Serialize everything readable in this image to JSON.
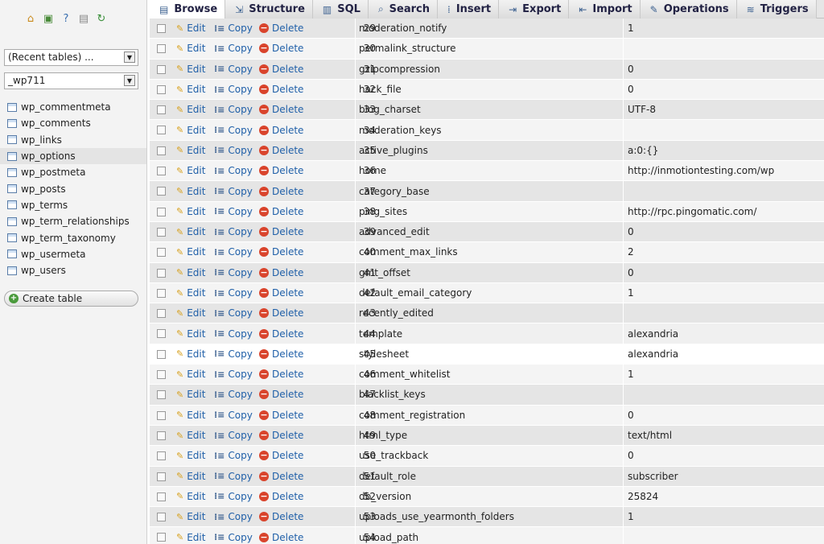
{
  "sidebar": {
    "top_icons": [
      {
        "name": "home-icon",
        "glyph": "⌂",
        "color": "#c98a1c"
      },
      {
        "name": "logout-icon",
        "glyph": "▣",
        "color": "#4a8b3a"
      },
      {
        "name": "help-icon",
        "glyph": "?",
        "color": "#3a6fb0"
      },
      {
        "name": "docs-icon",
        "glyph": "▤",
        "color": "#888888"
      },
      {
        "name": "reload-icon",
        "glyph": "↻",
        "color": "#3a8f3a"
      }
    ],
    "recent_tables": "(Recent tables) ...",
    "database": "_wp711",
    "tables": [
      "wp_commentmeta",
      "wp_comments",
      "wp_links",
      "wp_options",
      "wp_postmeta",
      "wp_posts",
      "wp_terms",
      "wp_term_relationships",
      "wp_term_taxonomy",
      "wp_usermeta",
      "wp_users"
    ],
    "active_table": "wp_options",
    "create_table": "Create table"
  },
  "tabs": [
    {
      "label": "Browse",
      "icon": "▤",
      "active": true
    },
    {
      "label": "Structure",
      "icon": "⇲"
    },
    {
      "label": "SQL",
      "icon": "▥"
    },
    {
      "label": "Search",
      "icon": "⌕"
    },
    {
      "label": "Insert",
      "icon": "⁞"
    },
    {
      "label": "Export",
      "icon": "⇥"
    },
    {
      "label": "Import",
      "icon": "⇤"
    },
    {
      "label": "Operations",
      "icon": "✎"
    },
    {
      "label": "Triggers",
      "icon": "≋"
    }
  ],
  "actions": {
    "edit": "Edit",
    "copy": "Copy",
    "delete": "Delete"
  },
  "rows": [
    {
      "id": "29",
      "name": "moderation_notify",
      "value": "1"
    },
    {
      "id": "30",
      "name": "permalink_structure",
      "value": ""
    },
    {
      "id": "31",
      "name": "gzipcompression",
      "value": "0"
    },
    {
      "id": "32",
      "name": "hack_file",
      "value": "0"
    },
    {
      "id": "33",
      "name": "blog_charset",
      "value": "UTF-8"
    },
    {
      "id": "34",
      "name": "moderation_keys",
      "value": ""
    },
    {
      "id": "35",
      "name": "active_plugins",
      "value": "a:0:{}"
    },
    {
      "id": "36",
      "name": "home",
      "value": "http://inmotiontesting.com/wp"
    },
    {
      "id": "37",
      "name": "category_base",
      "value": ""
    },
    {
      "id": "38",
      "name": "ping_sites",
      "value": "http://rpc.pingomatic.com/"
    },
    {
      "id": "39",
      "name": "advanced_edit",
      "value": "0"
    },
    {
      "id": "40",
      "name": "comment_max_links",
      "value": "2"
    },
    {
      "id": "41",
      "name": "gmt_offset",
      "value": "0"
    },
    {
      "id": "42",
      "name": "default_email_category",
      "value": "1"
    },
    {
      "id": "43",
      "name": "recently_edited",
      "value": ""
    },
    {
      "id": "44",
      "name": "template",
      "value": "alexandria",
      "state": "hover"
    },
    {
      "id": "45",
      "name": "stylesheet",
      "value": "alexandria",
      "state": "selected"
    },
    {
      "id": "46",
      "name": "comment_whitelist",
      "value": "1"
    },
    {
      "id": "47",
      "name": "blacklist_keys",
      "value": ""
    },
    {
      "id": "48",
      "name": "comment_registration",
      "value": "0"
    },
    {
      "id": "49",
      "name": "html_type",
      "value": "text/html"
    },
    {
      "id": "50",
      "name": "use_trackback",
      "value": "0"
    },
    {
      "id": "51",
      "name": "default_role",
      "value": "subscriber"
    },
    {
      "id": "52",
      "name": "db_version",
      "value": "25824"
    },
    {
      "id": "53",
      "name": "uploads_use_yearmonth_folders",
      "value": "1"
    },
    {
      "id": "54",
      "name": "upload_path",
      "value": ""
    }
  ]
}
